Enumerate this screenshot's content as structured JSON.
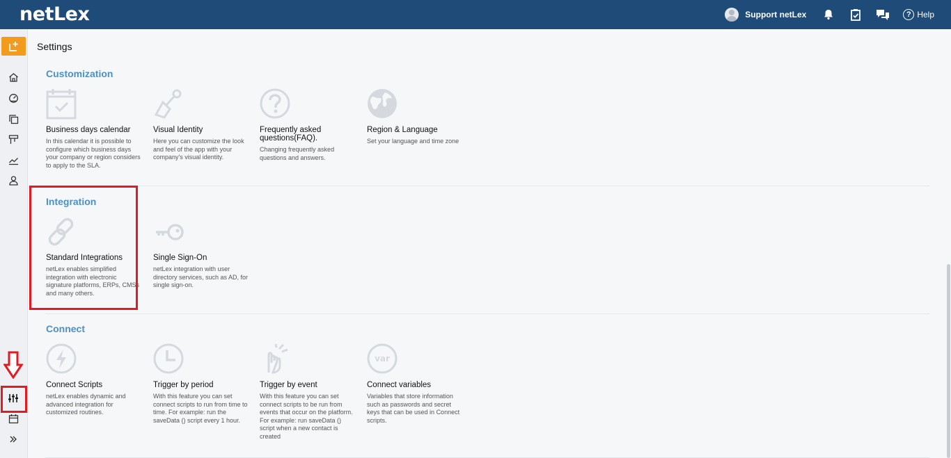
{
  "header": {
    "logo": "netLex",
    "user_name": "Support netLex",
    "help_label": "Help",
    "icons": [
      "user-avatar",
      "bell-icon",
      "clipboard-check-icon",
      "chat-icon",
      "help-icon"
    ]
  },
  "sidebar": {
    "items": [
      "new-icon",
      "home-icon",
      "dashboard-icon",
      "documents-icon",
      "board-icon",
      "chart-icon",
      "user-icon",
      "settings-sliders-icon",
      "calendar-icon",
      "expand-icon"
    ]
  },
  "page": {
    "title": "Settings"
  },
  "sections": [
    {
      "title": "Customization",
      "cards": [
        {
          "title": "Business days calendar",
          "desc": "In this calendar it is possible to configure which business days your company or region considers to apply to the SLA.",
          "icon": "calendar-check-icon"
        },
        {
          "title": "Visual Identity",
          "desc": "Here you can customize the look and feel of the app with your company's visual identity.",
          "icon": "paint-brush-icon"
        },
        {
          "title": "Frequently asked questions(FAQ).",
          "desc": "Changing frequently asked questions and answers.",
          "icon": "question-circle-icon"
        },
        {
          "title": "Region & Language",
          "desc": "Set your language and time zone",
          "icon": "globe-icon"
        }
      ]
    },
    {
      "title": "Integration",
      "cards": [
        {
          "title": "Standard Integrations",
          "desc": "netLex enables simplified integration with electronic signature platforms, ERPs, CMSs and many others.",
          "icon": "link-icon"
        },
        {
          "title": "Single Sign-On",
          "desc": "netLex integration with user directory services, such as AD, for single sign-on.",
          "icon": "key-icon"
        }
      ]
    },
    {
      "title": "Connect",
      "cards": [
        {
          "title": "Connect Scripts",
          "desc": "netLex enables dynamic and advanced integration for customized routines.",
          "icon": "bolt-icon"
        },
        {
          "title": "Trigger by period",
          "desc": "With this feature you can set connect scripts to run from time to time. For example: run the saveData () script every 1 hour.",
          "icon": "clock-icon"
        },
        {
          "title": "Trigger by event",
          "desc": "With this feature you can set connect scripts to be run from events that occur on the platform. For example: run saveData () script when a new contact is created",
          "icon": "hand-pointer-icon"
        },
        {
          "title": "Connect variables",
          "desc": "Variables that store information such as passwords and secret keys that can be used in Connect scripts.",
          "icon": "var-icon"
        }
      ]
    }
  ],
  "colors": {
    "topbar": "#1f4b79",
    "accent": "#4d90c3",
    "new_button": "#f29b1d",
    "annotation": "#e11b22"
  }
}
